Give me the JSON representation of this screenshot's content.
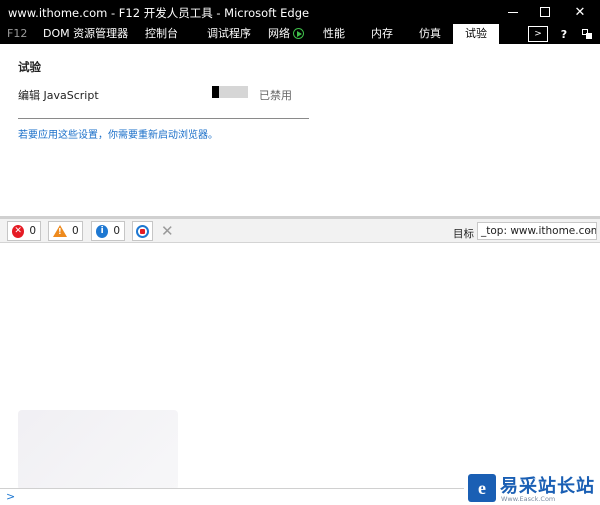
{
  "window": {
    "title": "www.ithome.com - F12 开发人员工具 - Microsoft Edge"
  },
  "tabs": {
    "f12": "F12",
    "items": [
      "DOM 资源管理器",
      "控制台",
      "调试程序",
      "网络",
      "性能",
      "内存",
      "仿真",
      "试验"
    ],
    "active": "试验"
  },
  "experiments": {
    "title": "试验",
    "setting_label": "编辑 JavaScript",
    "toggle_state": "已禁用",
    "toggle_on": false,
    "notice": "若要应用这些设置，你需要重新启动浏览器。"
  },
  "console": {
    "errors": "0",
    "warnings": "0",
    "messages": "0",
    "target_label": "目标",
    "target_value": "_top: www.ithome.com",
    "prompt": ">"
  },
  "logo": {
    "text": "易采站长站",
    "sub": "Www.Easck.Com"
  },
  "colors": {
    "titlebar": "#000000",
    "accent": "#1a6fc9",
    "error": "#e51b24",
    "warning": "#ee8a1d",
    "info": "#1e78d2"
  }
}
